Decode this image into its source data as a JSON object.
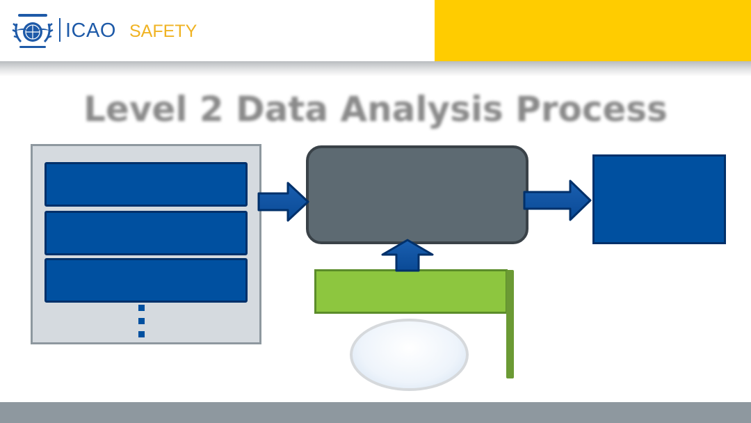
{
  "header": {
    "logo_name": "ICAO",
    "section": "SAFETY",
    "emblem_icon": "icao-emblem-icon",
    "brand_color": "#1e5aa8",
    "section_color": "#f0b323",
    "accent_color": "#ffcc00"
  },
  "slide": {
    "title": "Level 2 Data Analysis Process"
  },
  "diagram": {
    "input_list_items": 3,
    "colors": {
      "input_blue": "#0050a0",
      "process_gray": "#5d6a72",
      "input_green": "#8dc63f",
      "container_gray": "#d5dadf",
      "footer_gray": "#8e989f"
    },
    "icons": {
      "continuation": "vertical-ellipsis-icon",
      "arrow_right": "arrow-right-icon",
      "arrow_up": "arrow-up-icon"
    }
  }
}
